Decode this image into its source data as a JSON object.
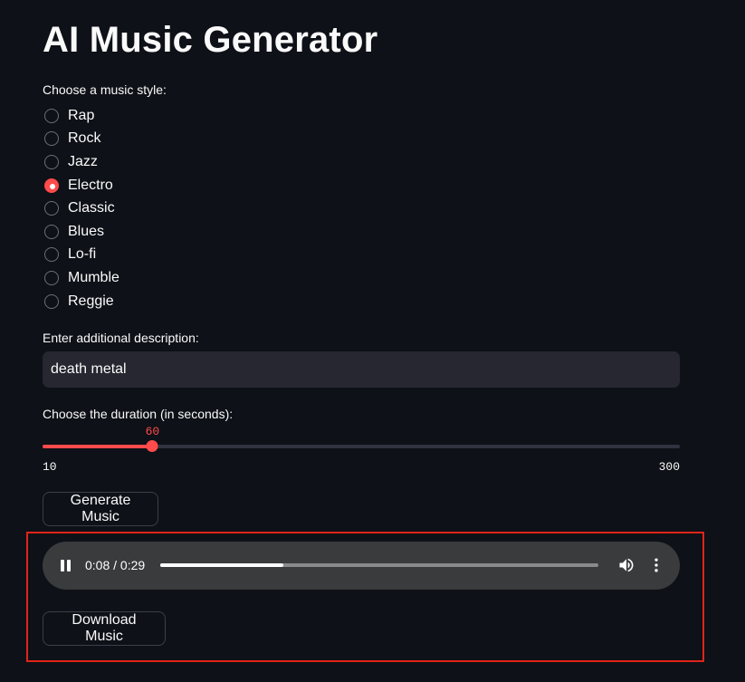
{
  "app": {
    "title": "AI Music Generator"
  },
  "style_selector": {
    "label": "Choose a music style:",
    "options": [
      "Rap",
      "Rock",
      "Jazz",
      "Electro",
      "Classic",
      "Blues",
      "Lo-fi",
      "Mumble",
      "Reggie"
    ],
    "selected": "Electro"
  },
  "description": {
    "label": "Enter additional description:",
    "value": "death metal"
  },
  "duration": {
    "label": "Choose the duration (in seconds):",
    "value": "60",
    "min": "10",
    "max": "300"
  },
  "generate_button": {
    "label": "Generate Music"
  },
  "audio_player": {
    "time": "0:08 / 0:29",
    "progress": 0.28,
    "state": "playing",
    "icons": [
      "pause-icon",
      "volume-icon",
      "more-options-icon"
    ]
  },
  "download_button": {
    "label": "Download Music"
  },
  "colors": {
    "background": "#0e1117",
    "accent": "#ff4b4b",
    "input_bg": "#262730",
    "highlight": "#e0241a"
  }
}
